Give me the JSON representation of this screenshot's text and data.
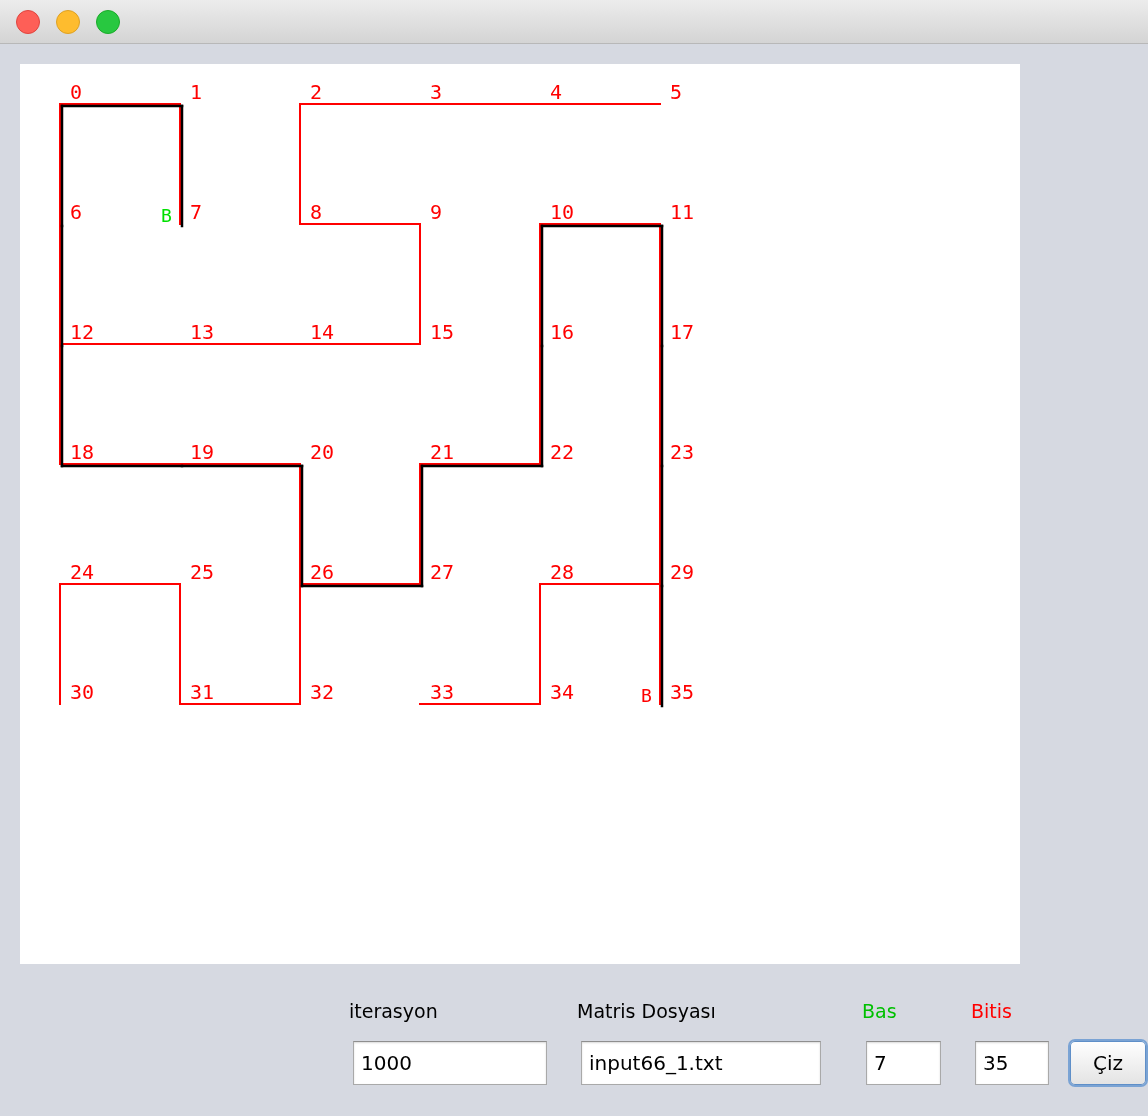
{
  "graph": {
    "rows": [
      [
        {
          "label": "0",
          "right": {
            "on_path": true
          },
          "down": {
            "on_path": true
          }
        },
        {
          "label": "1",
          "down": {
            "on_path": true
          }
        },
        {
          "label": "2",
          "right": {
            "on_path": false
          },
          "down": {
            "on_path": false
          }
        },
        {
          "label": "3",
          "right": {
            "on_path": false
          }
        },
        {
          "label": "4",
          "right": {
            "on_path": false
          }
        },
        {
          "label": "5"
        }
      ],
      [
        {
          "label": "6",
          "down": {
            "on_path": true
          }
        },
        {
          "label": "7",
          "marker": {
            "text": "B",
            "kind": "start"
          }
        },
        {
          "label": "8",
          "right": {
            "on_path": false
          }
        },
        {
          "label": "9",
          "down": {
            "on_path": false
          }
        },
        {
          "label": "10",
          "right": {
            "on_path": true
          },
          "down": {
            "on_path": true
          }
        },
        {
          "label": "11",
          "down": {
            "on_path": true
          }
        }
      ],
      [
        {
          "label": "12",
          "right": {
            "on_path": false
          },
          "down": {
            "on_path": true
          }
        },
        {
          "label": "13",
          "right": {
            "on_path": false
          }
        },
        {
          "label": "14",
          "right": {
            "on_path": false
          }
        },
        {
          "label": "15"
        },
        {
          "label": "16",
          "down": {
            "on_path": true
          }
        },
        {
          "label": "17",
          "down": {
            "on_path": true
          }
        }
      ],
      [
        {
          "label": "18",
          "right": {
            "on_path": true
          }
        },
        {
          "label": "19",
          "right": {
            "on_path": true
          }
        },
        {
          "label": "20",
          "down": {
            "on_path": true
          }
        },
        {
          "label": "21",
          "right": {
            "on_path": true
          },
          "down": {
            "on_path": true
          }
        },
        {
          "label": "22"
        },
        {
          "label": "23",
          "down": {
            "on_path": true
          }
        }
      ],
      [
        {
          "label": "24",
          "right": {
            "on_path": false
          },
          "down": {
            "on_path": false
          }
        },
        {
          "label": "25",
          "down": {
            "on_path": false
          }
        },
        {
          "label": "26",
          "right": {
            "on_path": true
          },
          "down": {
            "on_path": false
          }
        },
        {
          "label": "27"
        },
        {
          "label": "28",
          "right": {
            "on_path": false
          },
          "down": {
            "on_path": false
          }
        },
        {
          "label": "29",
          "down": {
            "on_path": true
          }
        }
      ],
      [
        {
          "label": "30"
        },
        {
          "label": "31",
          "right": {
            "on_path": false
          }
        },
        {
          "label": "32"
        },
        {
          "label": "33",
          "right": {
            "on_path": false
          }
        },
        {
          "label": "34"
        },
        {
          "label": "35",
          "marker": {
            "text": "B",
            "kind": "end"
          }
        }
      ]
    ]
  },
  "form": {
    "fields": [
      {
        "label": "iterasyon",
        "value": "1000",
        "color": "#000000"
      },
      {
        "label": "Matris Dosyası",
        "value": "input66_1.txt",
        "color": "#000000"
      },
      {
        "label": "Bas",
        "value": "7",
        "color": "#00c000"
      },
      {
        "label": "Bitis",
        "value": "35",
        "color": "#ff0000"
      }
    ],
    "button": "Çiz"
  }
}
